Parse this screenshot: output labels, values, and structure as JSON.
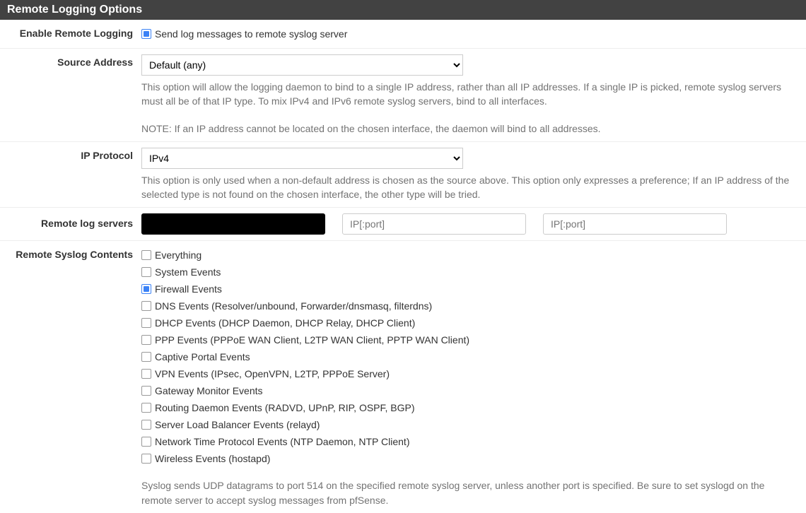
{
  "panel_title": "Remote Logging Options",
  "rows": {
    "enable": {
      "label": "Enable Remote Logging",
      "checkbox_label": "Send log messages to remote syslog server",
      "checked": true
    },
    "source": {
      "label": "Source Address",
      "selected": "Default (any)",
      "help1": "This option will allow the logging daemon to bind to a single IP address, rather than all IP addresses. If a single IP is picked, remote syslog servers must all be of that IP type. To mix IPv4 and IPv6 remote syslog servers, bind to all interfaces.",
      "help2": "NOTE: If an IP address cannot be located on the chosen interface, the daemon will bind to all addresses."
    },
    "ipproto": {
      "label": "IP Protocol",
      "selected": "IPv4",
      "help": "This option is only used when a non-default address is chosen as the source above. This option only expresses a preference; If an IP address of the selected type is not found on the chosen interface, the other type will be tried."
    },
    "servers": {
      "label": "Remote log servers",
      "placeholder2": "IP[:port]",
      "placeholder3": "IP[:port]"
    },
    "contents": {
      "label": "Remote Syslog Contents",
      "items": [
        {
          "label": "Everything",
          "checked": false
        },
        {
          "label": "System Events",
          "checked": false
        },
        {
          "label": "Firewall Events",
          "checked": true
        },
        {
          "label": "DNS Events (Resolver/unbound, Forwarder/dnsmasq, filterdns)",
          "checked": false
        },
        {
          "label": "DHCP Events (DHCP Daemon, DHCP Relay, DHCP Client)",
          "checked": false
        },
        {
          "label": "PPP Events (PPPoE WAN Client, L2TP WAN Client, PPTP WAN Client)",
          "checked": false
        },
        {
          "label": "Captive Portal Events",
          "checked": false
        },
        {
          "label": "VPN Events (IPsec, OpenVPN, L2TP, PPPoE Server)",
          "checked": false
        },
        {
          "label": "Gateway Monitor Events",
          "checked": false
        },
        {
          "label": "Routing Daemon Events (RADVD, UPnP, RIP, OSPF, BGP)",
          "checked": false
        },
        {
          "label": "Server Load Balancer Events (relayd)",
          "checked": false
        },
        {
          "label": "Network Time Protocol Events (NTP Daemon, NTP Client)",
          "checked": false
        },
        {
          "label": "Wireless Events (hostapd)",
          "checked": false
        }
      ],
      "help": "Syslog sends UDP datagrams to port 514 on the specified remote syslog server, unless another port is specified. Be sure to set syslogd on the remote server to accept syslog messages from pfSense."
    }
  }
}
